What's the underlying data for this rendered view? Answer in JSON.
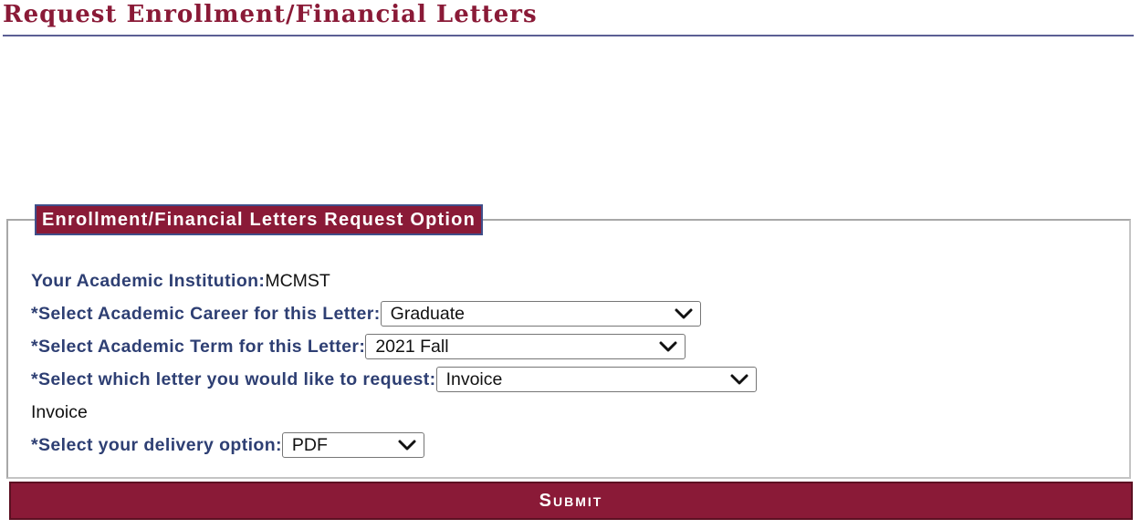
{
  "page": {
    "title": "Request Enrollment/Financial Letters"
  },
  "group": {
    "legend": "Enrollment/Financial Letters Request Option",
    "institution_label": "Your Academic Institution:",
    "institution_value": "MCMST",
    "career_label": "*Select Academic Career for this Letter:",
    "career_value": "Graduate",
    "term_label": "*Select Academic Term for this Letter:",
    "term_value": "2021 Fall",
    "letter_label": "*Select which letter you would like to request:",
    "letter_value": "Invoice",
    "letter_text": "Invoice",
    "delivery_label": "*Select your delivery option:",
    "delivery_value": "PDF"
  },
  "submit_label": "Submit",
  "icons": {
    "dropdown": "chevron-down-icon"
  },
  "colors": {
    "brand": "#8a1a37",
    "label": "#2e3f73",
    "rule": "#5b5f94"
  }
}
